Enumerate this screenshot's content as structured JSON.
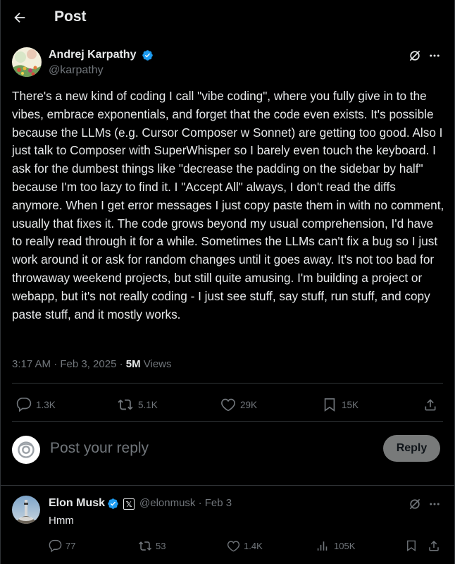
{
  "header": {
    "title": "Post"
  },
  "post": {
    "author_name": "Andrej Karpathy",
    "author_handle": "@karpathy",
    "text": "There's a new kind of coding I call \"vibe coding\", where you fully give in to the vibes, embrace exponentials, and forget that the code even exists. It's possible because the LLMs (e.g. Cursor Composer w Sonnet) are getting too good. Also I just talk to Composer with SuperWhisper so I barely even touch the keyboard. I ask for the dumbest things like \"decrease the padding on the sidebar by half\" because I'm too lazy to find it. I \"Accept All\" always, I don't read the diffs anymore. When I get error messages I just copy paste them in with no comment, usually that fixes it. The code grows beyond my usual comprehension, I'd have to really read through it for a while. Sometimes the LLMs can't fix a bug so I just work around it or ask for random changes until it goes away. It's not too bad for throwaway weekend projects, but still quite amusing. I'm building a project or webapp, but it's not really coding - I just see stuff, say stuff, run stuff, and copy paste stuff, and it mostly works.",
    "timestamp": "3:17 AM · Feb 3, 2025 · ",
    "views_count": "5M",
    "views_label": " Views",
    "stats": {
      "replies": "1.3K",
      "reposts": "5.1K",
      "likes": "29K",
      "bookmarks": "15K"
    }
  },
  "composer": {
    "placeholder": "Post your reply",
    "button": "Reply"
  },
  "reply": {
    "author_name": "Elon Musk",
    "x_badge": "𝕏",
    "handle_date": "@elonmusk · Feb 3",
    "text": "Hmm",
    "stats": {
      "replies": "77",
      "reposts": "53",
      "likes": "1.4K",
      "views": "105K"
    }
  },
  "colors": {
    "background": "#000000",
    "text": "#e7e9ea",
    "muted": "#71767b",
    "verified": "#1d9bf0",
    "divider": "#2f3336"
  }
}
